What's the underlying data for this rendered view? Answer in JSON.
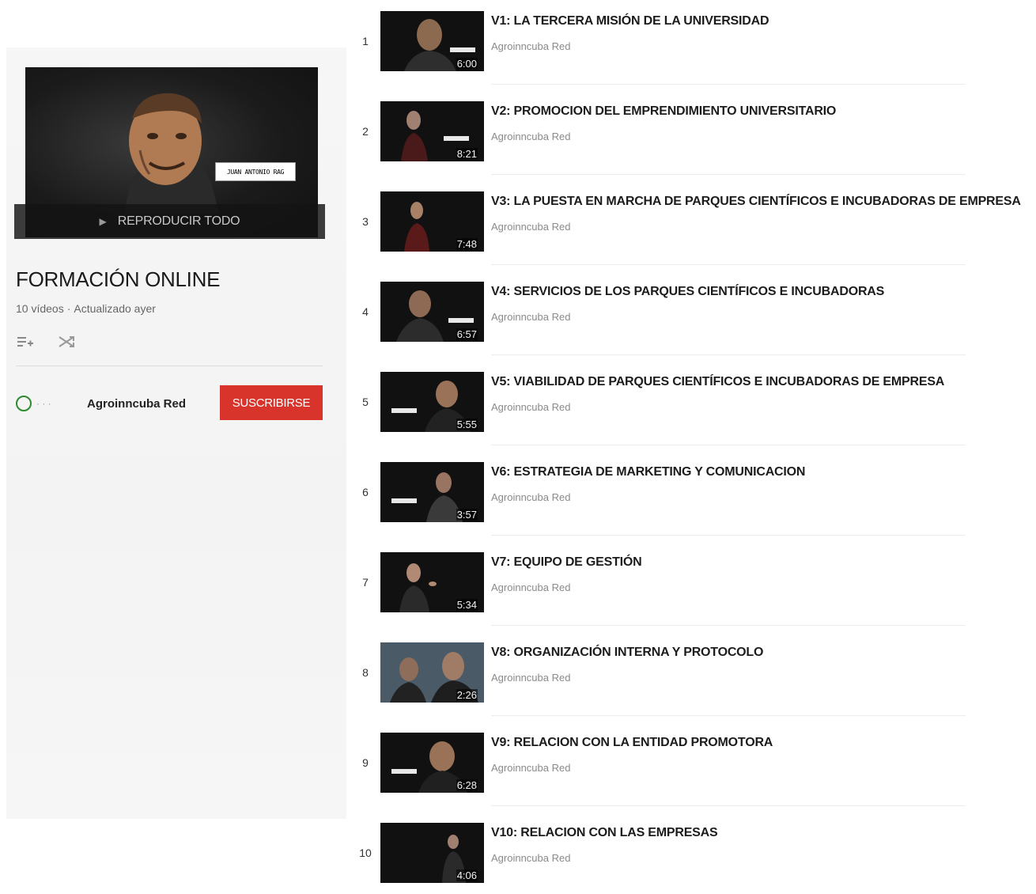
{
  "playlist": {
    "play_all_label": "REPRODUCIR TODO",
    "title": "FORMACIÓN ONLINE",
    "video_count": "10 vídeos",
    "updated": "Actualizado ayer",
    "hero_caption": "JUAN ANTONIO RAG"
  },
  "owner": {
    "name": "Agroinncuba Red",
    "subscribe_label": "SUSCRIBIRSE"
  },
  "videos": [
    {
      "index": "1",
      "title": "V1: LA TERCERA MISIÓN DE LA UNIVERSIDAD",
      "channel": "Agroinncuba Red",
      "duration": "6:00"
    },
    {
      "index": "2",
      "title": "V2: PROMOCION DEL EMPRENDIMIENTO UNIVERSITARIO",
      "channel": "Agroinncuba Red",
      "duration": "8:21"
    },
    {
      "index": "3",
      "title": "V3: LA PUESTA EN MARCHA DE PARQUES CIENTÍFICOS E INCUBADORAS DE EMPRESA",
      "channel": "Agroinncuba Red",
      "duration": "7:48"
    },
    {
      "index": "4",
      "title": "V4: SERVICIOS DE LOS PARQUES CIENTÍFICOS E INCUBADORAS",
      "channel": "Agroinncuba Red",
      "duration": "6:57"
    },
    {
      "index": "5",
      "title": "V5: VIABILIDAD DE PARQUES CIENTÍFICOS E INCUBADORAS DE EMPRESA",
      "channel": "Agroinncuba Red",
      "duration": "5:55"
    },
    {
      "index": "6",
      "title": "V6: ESTRATEGIA DE MARKETING Y COMUNICACION",
      "channel": "Agroinncuba Red",
      "duration": "3:57"
    },
    {
      "index": "7",
      "title": "V7: EQUIPO DE GESTIÓN",
      "channel": "Agroinncuba Red",
      "duration": "5:34"
    },
    {
      "index": "8",
      "title": "V8: ORGANIZACIÓN INTERNA Y PROTOCOLO",
      "channel": "Agroinncuba Red",
      "duration": "2:26"
    },
    {
      "index": "9",
      "title": "V9: RELACION CON LA ENTIDAD PROMOTORA",
      "channel": "Agroinncuba Red",
      "duration": "6:28"
    },
    {
      "index": "10",
      "title": "V10: RELACION CON LAS EMPRESAS",
      "channel": "Agroinncuba Red",
      "duration": "4:06"
    }
  ],
  "colors": {
    "subscribe": "#d9342b",
    "avatar_ring": "#2e8b2e",
    "title_text": "#1c1c1c",
    "meta_text": "#8a8a8a"
  },
  "icons": {
    "add_to_queue": "add-to-playlist-icon",
    "shuffle": "shuffle-icon",
    "play": "play-icon"
  }
}
